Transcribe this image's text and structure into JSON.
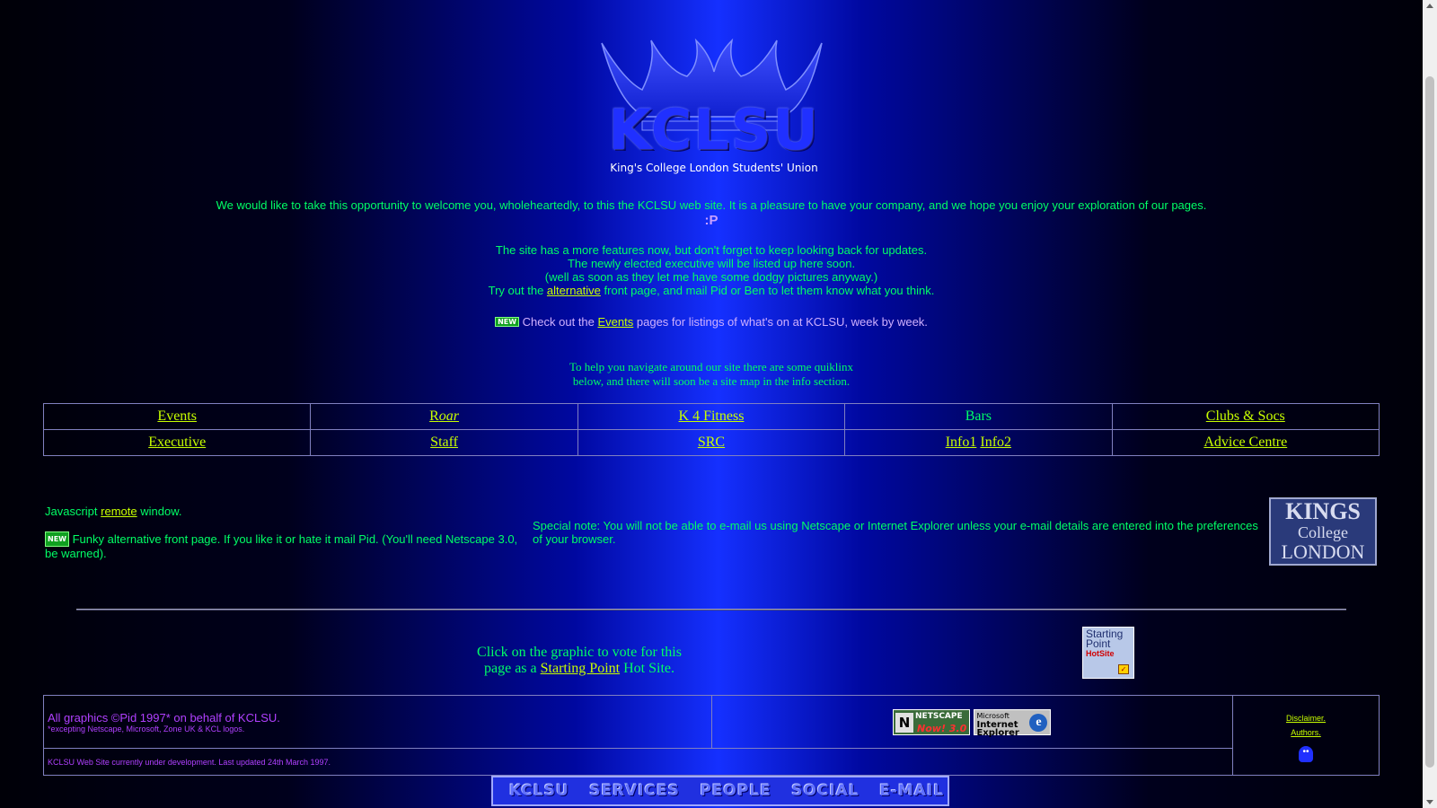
{
  "logo": {
    "title": "KCLSU",
    "subtitle": "King's College London Students' Union"
  },
  "intro": {
    "welcome": "We would like to take this opportunity to welcome you, wholeheartedly, to this the KCLSU web site. It is a pleasure to have your company, and we hope you enjoy your exploration of our pages.",
    "smiley": ":P",
    "features_line1": "The site has a more features now, but don't forget to keep looking back for updates.",
    "features_line2": "The newly elected executive will be listed up here soon.",
    "features_line3": "(well as soon as they let me have some dodgy pictures anyway.)",
    "try_prefix": "Try out the",
    "try_link": "alternative",
    "try_suffix": "front page, and mail Pid or Ben to let them know what you think.",
    "new_badge": "NEW",
    "events_prefix": "Check out the",
    "events_link": "Events",
    "events_suffix": "pages for listings of what's on at KCLSU, week by week.",
    "help_line1": "To help you navigate around our site there are some quiklinx",
    "help_line2": "below, and there will soon be a site map in the info section."
  },
  "quicklinks": {
    "row1": {
      "events": "Events",
      "roar_r": "R",
      "roar_rest": "oar",
      "fitness": "K 4 Fitness",
      "bars": "Bars",
      "clubs": "Clubs & Socs"
    },
    "row2": {
      "executive": "Executive",
      "staff": "Staff",
      "src": "SRC",
      "info1": "Info1",
      "info2": "Info2",
      "advice": "Advice Centre"
    }
  },
  "notes": {
    "js_prefix": "Javascript",
    "js_link": "remote",
    "js_suffix": "window.",
    "funky": "Funky alternative front page. If you like it or hate it mail Pid. (You'll need Netscape 3.0, be warned).",
    "special": "Special note: You will not be able to e-mail us using Netscape or Internet Explorer unless your e-mail details are entered into the preferences of your browser.",
    "kcl_logo_l1": "KINGS",
    "kcl_logo_l2": "College",
    "kcl_logo_l3": "LONDON"
  },
  "vote": {
    "line1": "Click on the graphic to vote for this",
    "prefix": "page as a",
    "link": "Starting Point",
    "suffix": "Hot Site.",
    "badge_line1": "Starting",
    "badge_line2": "Point",
    "badge_hot": "HotSite"
  },
  "footer": {
    "graphics": "All graphics ©Pid 1997* on behalf of KCLSU.",
    "graphics_note": "*excepting Netscape, Microsoft, Zone UK & KCL logos.",
    "netscape_label": "NETSCAPE",
    "netscape_now": "Now! 3.0",
    "ie_label1": "Microsoft",
    "ie_label2": "Internet",
    "ie_label3": "Explorer",
    "disclaimer": "Disclaimer.",
    "authors": "Authors.",
    "status": "KCLSU Web Site currently under development. Last updated 24th March 1997."
  },
  "navbar": {
    "items": [
      "KCLSU",
      "SERVICES",
      "PEOPLE",
      "SOCIAL",
      "E-MAIL"
    ]
  },
  "colors": {
    "text_green": "#00ff66",
    "link_lime": "#c8ff00",
    "violet": "#b040ff"
  }
}
